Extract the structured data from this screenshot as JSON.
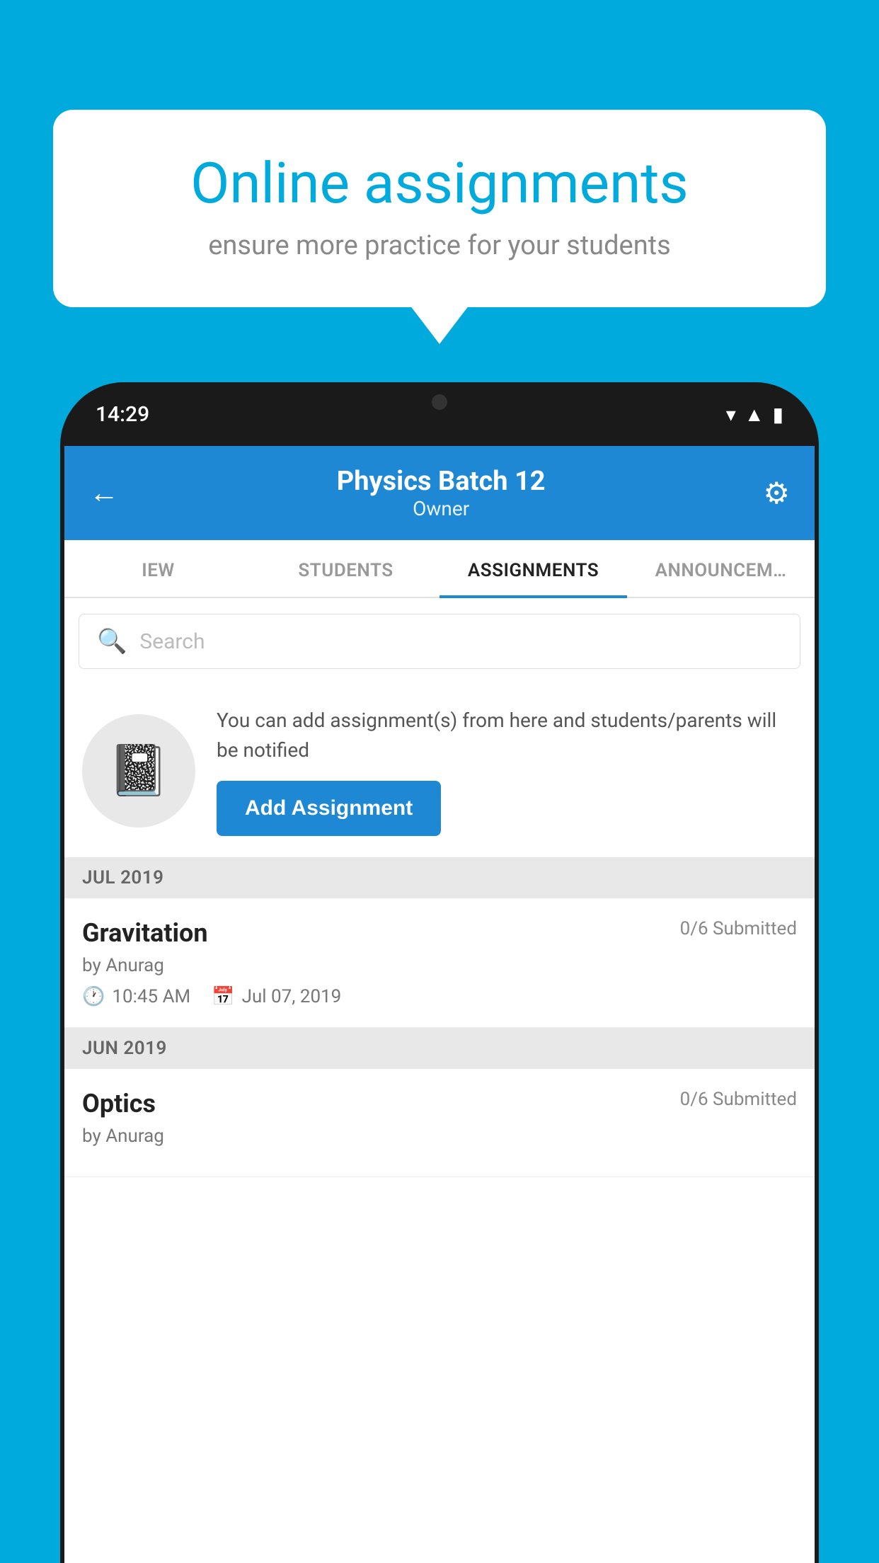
{
  "background": {
    "color": "#00AADC"
  },
  "speech_bubble": {
    "title": "Online assignments",
    "subtitle": "ensure more practice for your students"
  },
  "phone": {
    "status_bar": {
      "time": "14:29"
    },
    "header": {
      "title": "Physics Batch 12",
      "subtitle": "Owner",
      "back_label": "←",
      "settings_label": "⚙"
    },
    "tabs": [
      {
        "label": "IEW",
        "active": false
      },
      {
        "label": "STUDENTS",
        "active": false
      },
      {
        "label": "ASSIGNMENTS",
        "active": true
      },
      {
        "label": "ANNOUNCEM…",
        "active": false
      }
    ],
    "search": {
      "placeholder": "Search"
    },
    "promo": {
      "description": "You can add assignment(s) from here and students/parents will be notified",
      "button_label": "Add Assignment"
    },
    "sections": [
      {
        "header": "JUL 2019",
        "assignments": [
          {
            "name": "Gravitation",
            "submitted": "0/6 Submitted",
            "by": "by Anurag",
            "time": "10:45 AM",
            "date": "Jul 07, 2019"
          }
        ]
      },
      {
        "header": "JUN 2019",
        "assignments": [
          {
            "name": "Optics",
            "submitted": "0/6 Submitted",
            "by": "by Anurag",
            "time": "",
            "date": ""
          }
        ]
      }
    ]
  }
}
